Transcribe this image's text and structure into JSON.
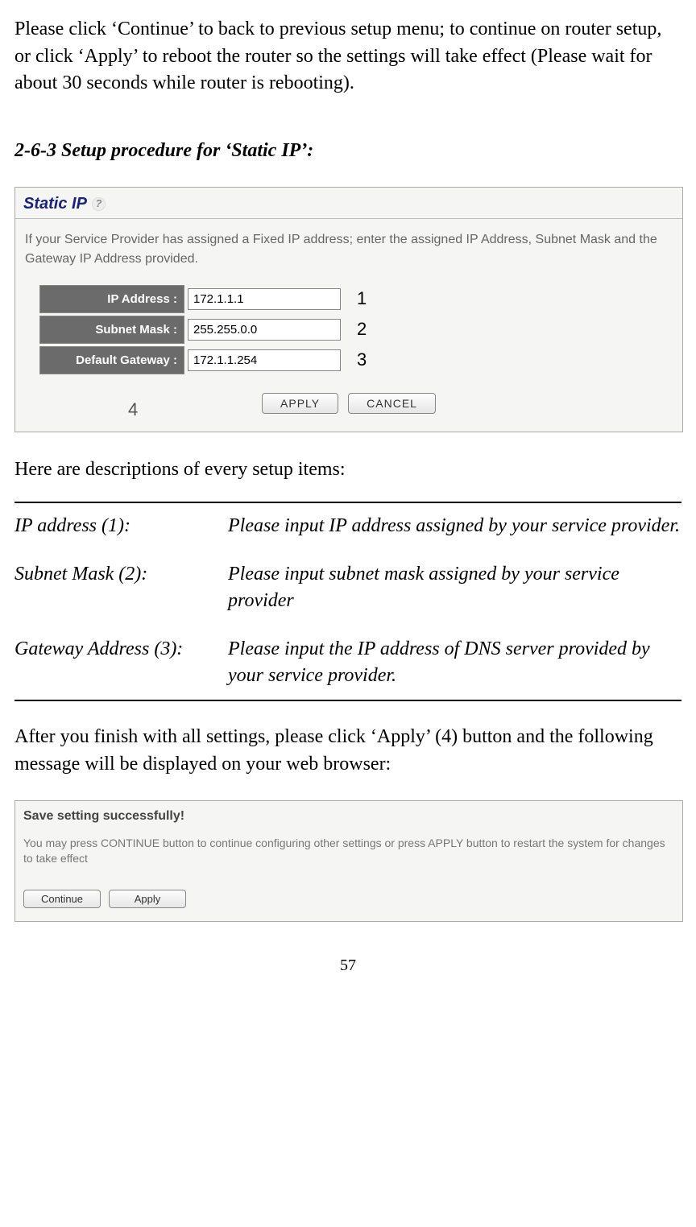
{
  "intro_paragraph": "Please click ‘Continue’ to back to previous setup menu; to continue on router setup, or click ‘Apply’ to reboot the router so the settings will take effect (Please wait for about 30 seconds while router is rebooting).",
  "section_heading": "2-6-3 Setup procedure for ‘Static IP’:",
  "screenshot1": {
    "title": "Static IP",
    "description": "If your Service Provider has assigned a Fixed IP address; enter the assigned IP Address, Subnet Mask and the Gateway IP Address provided.",
    "fields": [
      {
        "label": "IP Address :",
        "value": "172.1.1.1",
        "callout": "1"
      },
      {
        "label": "Subnet Mask :",
        "value": "255.255.0.0",
        "callout": "2"
      },
      {
        "label": "Default Gateway :",
        "value": "172.1.1.254",
        "callout": "3"
      }
    ],
    "apply_label": "APPLY",
    "cancel_label": "CANCEL",
    "callout_4": "4"
  },
  "descriptions_intro": "Here are descriptions of every setup items:",
  "descriptions": [
    {
      "term": "IP address (1):",
      "def": "Please input IP address assigned by your service provider."
    },
    {
      "term": "Subnet Mask (2):",
      "def": "Please input subnet mask assigned by your service provider"
    },
    {
      "term": "Gateway Address (3):",
      "def": "Please input the IP address of DNS server provided by your service provider."
    }
  ],
  "after_paragraph": "After you finish with all settings, please click ‘Apply’ (4) button and the following message will be displayed on your web browser:",
  "screenshot2": {
    "title": "Save setting successfully!",
    "description": "You may press CONTINUE button to continue configuring other settings or press APPLY button to restart the system for changes to take effect",
    "continue_label": "Continue",
    "apply_label": "Apply"
  },
  "page_number": "57"
}
